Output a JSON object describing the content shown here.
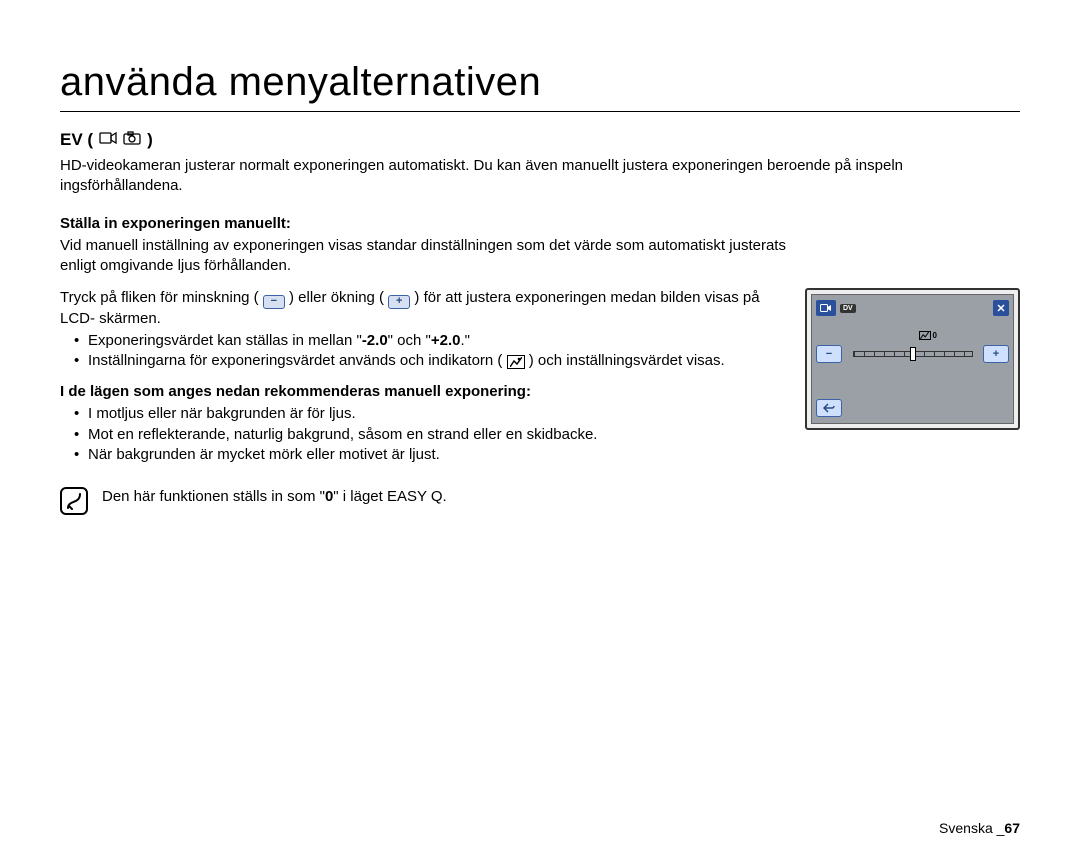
{
  "title": "använda menyalternativen",
  "section": {
    "heading": "EV (",
    "heading_close": " )",
    "intro": "HD-videokameran justerar normalt exponeringen automatiskt. Du kan även manuellt justera exponeringen beroende på inspeln ingsförhållandena.",
    "sub1": "Ställa in exponeringen manuellt:",
    "p1": "Vid manuell inställning av exponeringen visas standar dinställningen som det värde som automatiskt justerats enligt omgivande ljus förhållanden.",
    "p2a": "Tryck på fliken för minskning (",
    "p2b": ") eller ökning (",
    "p2c": ") för att justera exponeringen medan bilden visas på LCD- skärmen.",
    "b1a": "Exponeringsvärdet kan ställas in mellan \"",
    "b1_neg": "-2.0",
    "b1_mid": "\" och \"",
    "b1_pos": "+2.0",
    "b1_end": ".\"",
    "b2a": "Inställningarna för exponeringsvärdet används och indikatorn (",
    "b2b": ") och inställningsvärdet visas.",
    "sub2": "I de lägen som anges nedan rekommenderas manuell exponering:",
    "r1": "I motljus eller när bakgrunden är för ljus.",
    "r2": "Mot en reflekterande, naturlig bakgrund, såsom en strand eller en skidbacke.",
    "r3": "När bakgrunden är mycket mörk eller motivet är ljust.",
    "note_a": "Den här funktionen ställs in som \"",
    "note_zero": "0",
    "note_b": "\" i läget EASY Q."
  },
  "lcd": {
    "mode_label": "DV",
    "value": "0",
    "minus": "−",
    "plus": "+"
  },
  "footer": {
    "lang": "Svenska ",
    "sep": "_",
    "page": "67"
  }
}
